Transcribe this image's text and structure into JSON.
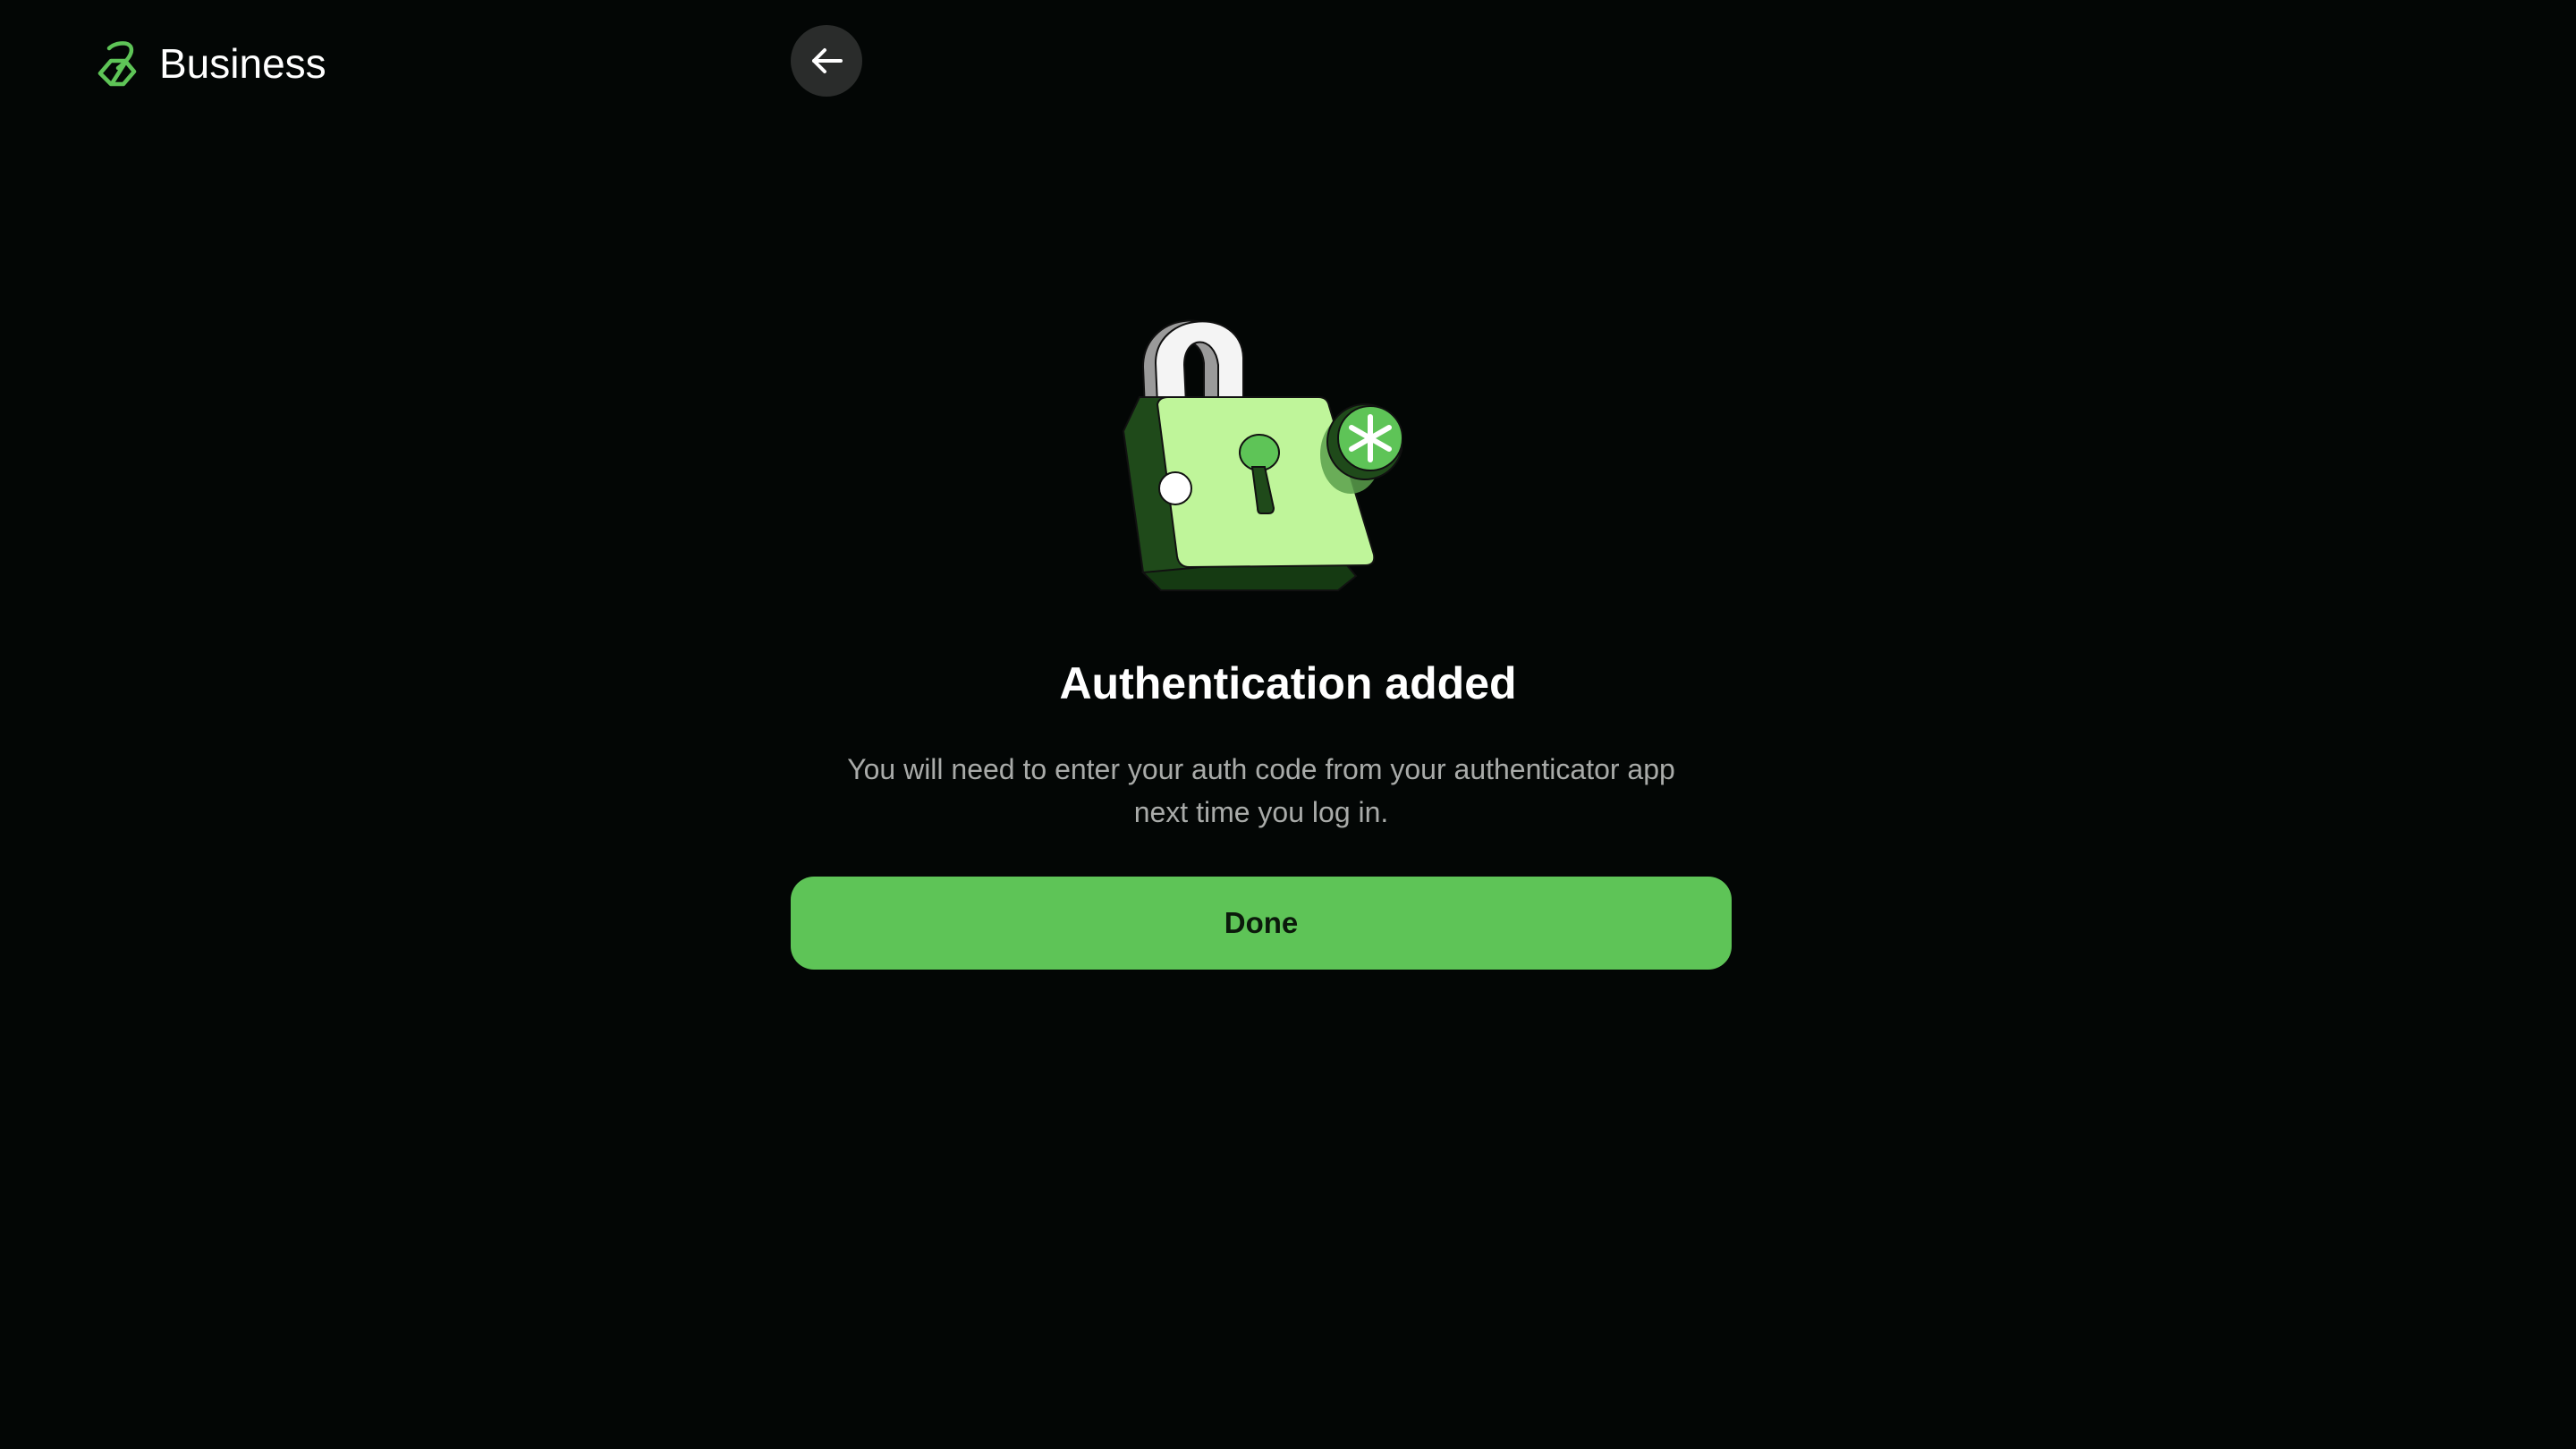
{
  "header": {
    "brand_text": "Business",
    "logo_icon": "business-leaf-logo",
    "back_icon": "arrow-left-icon"
  },
  "main": {
    "illustration_icon": "padlock-asterisk-icon",
    "title": "Authentication added",
    "description_line1": "You will need to enter your auth code from your authenticator app",
    "description_line2": "next time you log in.",
    "done_label": "Done"
  },
  "colors": {
    "background": "#030605",
    "accent": "#5ec457",
    "back_button_bg": "#2a2c2b",
    "muted_text": "#a9aba9"
  }
}
